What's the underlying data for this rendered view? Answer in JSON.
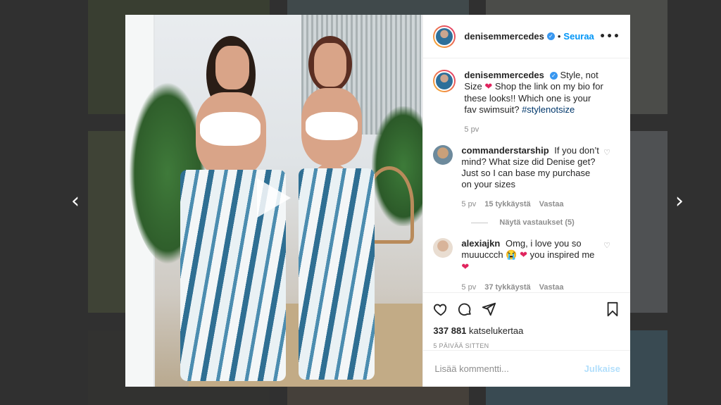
{
  "post": {
    "username": "denisemmercedes",
    "verified_icon": "verified-badge-icon",
    "separator": "•",
    "follow_label": "Seuraa",
    "more_icon": "ellipsis-icon"
  },
  "caption": {
    "username": "denisemmercedes",
    "text_1": "Style, not Size",
    "heart": "❤",
    "text_2": "Shop the link on my bio for these looks!! Which one is your fav swimsuit?",
    "hashtag": "#stylenotsize",
    "time": "5 pv"
  },
  "comments": [
    {
      "username": "commanderstarship",
      "text": "If you don’t mind? What size did Denise get? Just so I can base my purchase on your sizes",
      "time": "5 pv",
      "likes": "15 tykkäystä",
      "reply": "Vastaa",
      "view_replies": "Näytä vastaukset (5)"
    },
    {
      "username": "alexiajkn",
      "text_1": "Omg, i love you so muuuccch",
      "emoji": "😭",
      "heart": "❤",
      "text_2": "you inspired me",
      "heart_2": "❤",
      "time": "5 pv",
      "likes": "37 tykkäystä",
      "reply": "Vastaa"
    }
  ],
  "actions": {
    "like_icon": "heart-icon",
    "comment_icon": "comment-icon",
    "share_icon": "share-icon",
    "save_icon": "bookmark-icon",
    "views": "337 881",
    "views_label": "katselukertaa",
    "posted": "5 PÄIVÄÄ SITTEN"
  },
  "add_comment": {
    "placeholder": "Lisää kommentti...",
    "post_label": "Julkaise"
  },
  "nav": {
    "prev": "‹",
    "next": "›"
  },
  "colors": {
    "accent": "#0095f6",
    "post_disabled": "#b2dffc",
    "like_red": "#e0245e"
  }
}
